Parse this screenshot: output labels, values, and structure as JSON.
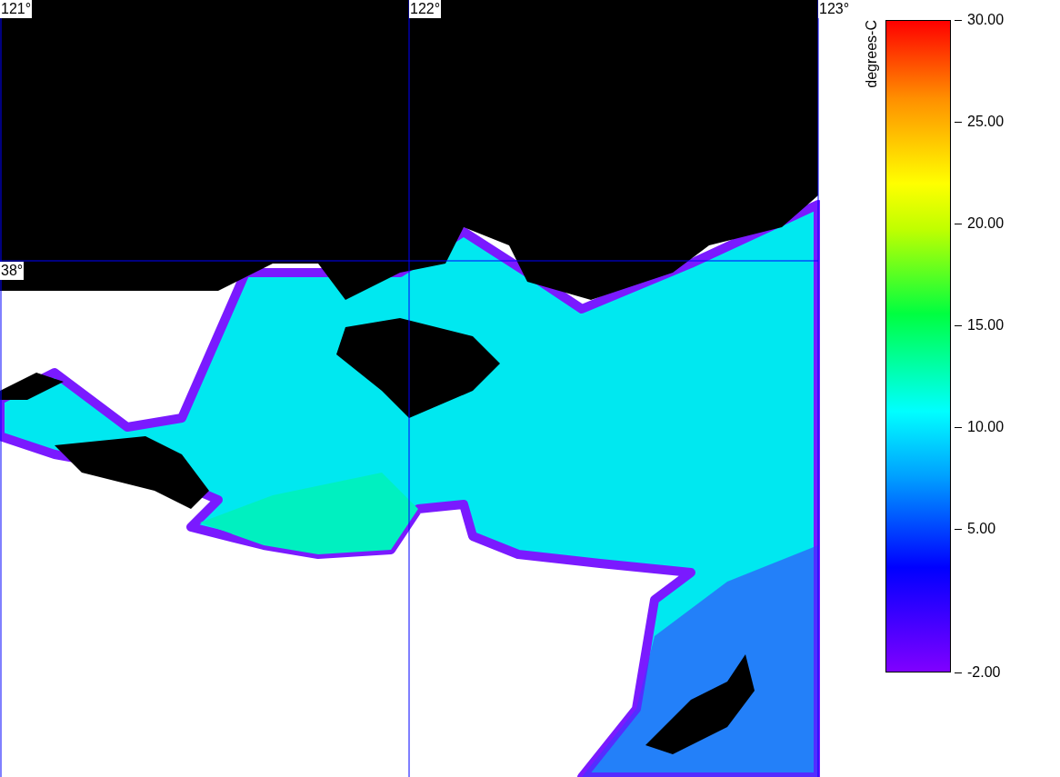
{
  "map": {
    "grid_labels": [
      {
        "text": "121°",
        "kind": "longitude"
      },
      {
        "text": "122°",
        "kind": "longitude"
      },
      {
        "text": "123°",
        "kind": "longitude"
      },
      {
        "text": "38°",
        "kind": "latitude"
      }
    ]
  },
  "colorbar": {
    "title": "degrees-C",
    "ticks": [
      "30.00",
      "25.00",
      "20.00",
      "15.00",
      "10.00",
      "5.00",
      "-2.00"
    ]
  }
}
